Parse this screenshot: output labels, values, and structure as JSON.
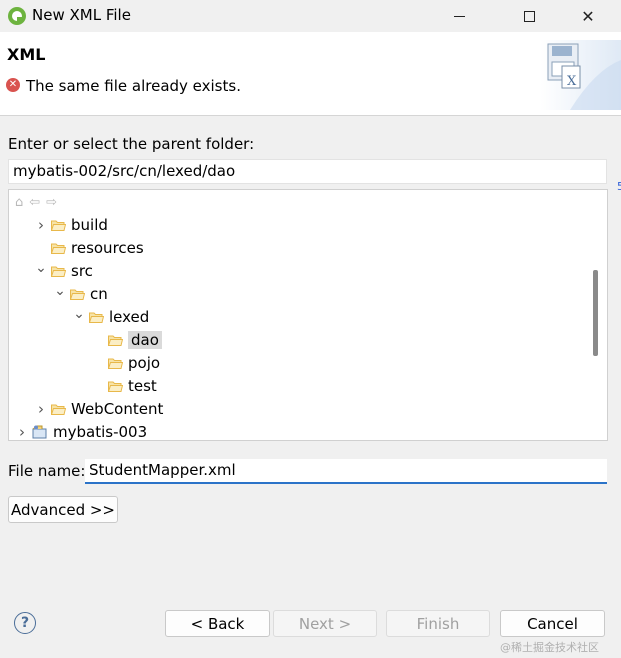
{
  "window": {
    "title": "New XML File"
  },
  "header": {
    "title": "XML",
    "message": "The same file already exists."
  },
  "parent_folder": {
    "label": "Enter or select the parent folder:",
    "value": "mybatis-002/src/cn/lexed/dao"
  },
  "tree": {
    "items": [
      {
        "label": "build",
        "type": "folder",
        "level": 1,
        "expander": "collapsed"
      },
      {
        "label": "resources",
        "type": "folder",
        "level": 1,
        "expander": "none"
      },
      {
        "label": "src",
        "type": "folder",
        "level": 1,
        "expander": "expanded"
      },
      {
        "label": "cn",
        "type": "folder",
        "level": 2,
        "expander": "expanded"
      },
      {
        "label": "lexed",
        "type": "folder",
        "level": 3,
        "expander": "expanded"
      },
      {
        "label": "dao",
        "type": "folder",
        "level": 4,
        "expander": "none",
        "selected": true
      },
      {
        "label": "pojo",
        "type": "folder",
        "level": 4,
        "expander": "none"
      },
      {
        "label": "test",
        "type": "folder",
        "level": 4,
        "expander": "none"
      },
      {
        "label": "WebContent",
        "type": "folder",
        "level": 1,
        "expander": "collapsed"
      },
      {
        "label": "mybatis-003",
        "type": "project",
        "level": 0,
        "expander": "collapsed"
      }
    ]
  },
  "file_name": {
    "label": "File name:",
    "value": "StudentMapper.xml"
  },
  "buttons": {
    "advanced": "Advanced >>",
    "back": "< Back",
    "next": "Next >",
    "finish": "Finish",
    "cancel": "Cancel"
  },
  "watermark": "@稀土掘金技术社区",
  "colors": {
    "accent": "#2b73c8",
    "error": "#d9534f",
    "folder": "#e8b84a"
  }
}
